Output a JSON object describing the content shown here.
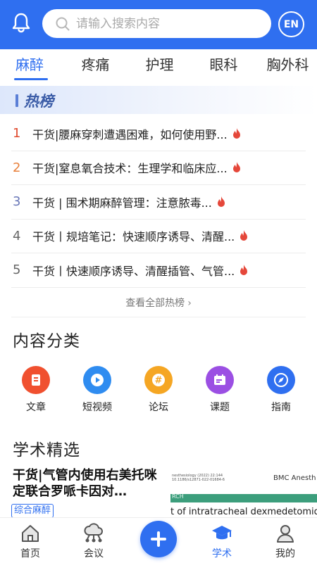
{
  "header": {
    "search_placeholder": "请输入搜索内容",
    "lang_label": "EN",
    "accent": "#2f6ff0"
  },
  "tabs": [
    {
      "label": "麻醉",
      "active": true
    },
    {
      "label": "疼痛"
    },
    {
      "label": "护理"
    },
    {
      "label": "眼科"
    },
    {
      "label": "胸外科"
    }
  ],
  "hot": {
    "title": "热榜",
    "items": [
      {
        "rank": "1",
        "text": "干货|腰麻穿刺遭遇困难，如何使用野...",
        "rank_color": "#e04a2e"
      },
      {
        "rank": "2",
        "text": "干货|窒息氧合技术：生理学和临床应...",
        "rank_color": "#e8803c"
      },
      {
        "rank": "3",
        "text": "干货 | 围术期麻醉管理：注意脓毒...",
        "rank_color": "#6a78b8"
      },
      {
        "rank": "4",
        "text": "干货丨规培笔记：快速顺序诱导、清醒...",
        "rank_color": "#666666"
      },
      {
        "rank": "5",
        "text": "干货丨快速顺序诱导、清醒插管、气管...",
        "rank_color": "#666666"
      }
    ],
    "view_all": "查看全部热榜"
  },
  "categories": {
    "title": "内容分类",
    "items": [
      {
        "label": "文章",
        "icon": "article-icon",
        "color": "#f0502f"
      },
      {
        "label": "短视频",
        "icon": "video-icon",
        "color": "#2f8cf0"
      },
      {
        "label": "论坛",
        "icon": "forum-icon",
        "color": "#f5a623"
      },
      {
        "label": "课题",
        "icon": "topic-icon",
        "color": "#9b4fe3"
      },
      {
        "label": "指南",
        "icon": "compass-icon",
        "color": "#2f6ff0"
      }
    ]
  },
  "academic": {
    "title": "学术精选",
    "card": {
      "title": "干货|气管内使用右美托咪定联合罗哌卡因对…",
      "tag": "综合麻醉",
      "thumb_small": "nesthesiology    (2022) 22:144",
      "thumb_doi": "10.1186/s12871-022-01684-6",
      "thumb_journal": "BMC Anesth",
      "thumb_band": "RCH",
      "thumb_headline": "t of intratracheal dexmedetomidine"
    }
  },
  "nav": [
    {
      "label": "首页",
      "icon": "home-icon"
    },
    {
      "label": "会议",
      "icon": "meeting-icon"
    },
    {
      "label": "",
      "icon": "plus-icon"
    },
    {
      "label": "学术",
      "icon": "academic-cap-icon",
      "active": true
    },
    {
      "label": "我的",
      "icon": "profile-icon"
    }
  ]
}
